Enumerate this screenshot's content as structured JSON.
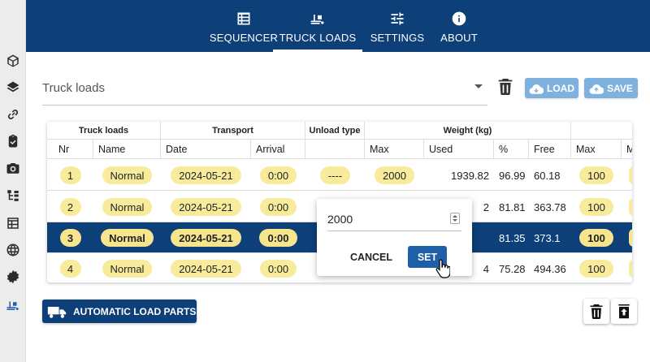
{
  "sidebar": {
    "items": [
      {
        "icon": "cube-icon"
      },
      {
        "icon": "layers-icon"
      },
      {
        "icon": "link-icon"
      },
      {
        "icon": "clipboard-check-icon"
      },
      {
        "icon": "camera-icon"
      },
      {
        "icon": "hierarchy-icon"
      },
      {
        "icon": "table-icon"
      },
      {
        "icon": "globe-icon"
      },
      {
        "icon": "gear-badge-icon"
      },
      {
        "icon": "truck-loading-icon",
        "active": true
      }
    ]
  },
  "nav": {
    "tabs": [
      {
        "label": "SEQUENCER",
        "icon": "list-icon"
      },
      {
        "label": "TRUCK LOADS",
        "icon": "truck-loading-icon",
        "active": true
      },
      {
        "label": "SETTINGS",
        "icon": "sliders-icon"
      },
      {
        "label": "ABOUT",
        "icon": "info-icon"
      }
    ]
  },
  "toolbar": {
    "select_value": "Truck loads",
    "load_label": "LOAD",
    "save_label": "SAVE"
  },
  "table": {
    "groups": [
      "Truck loads",
      "Transport",
      "Unload type",
      "Weight (kg)"
    ],
    "columns": [
      "Nr",
      "Name",
      "Date",
      "Arrival",
      "Max",
      "Used",
      "%",
      "Free",
      "Max",
      "M"
    ],
    "rows": [
      {
        "nr": "1",
        "name": "Normal",
        "date": "2024-05-21",
        "arrival": "0:00",
        "unload": "----",
        "max": "2000",
        "used": "1939.82",
        "pct": "96.99",
        "free": "60.18",
        "max2": "100",
        "selected": false
      },
      {
        "nr": "2",
        "name": "Normal",
        "date": "2024-05-21",
        "arrival": "0:00",
        "unload": "",
        "max": "",
        "used": "2",
        "pct": "81.81",
        "free": "363.78",
        "max2": "100",
        "selected": false
      },
      {
        "nr": "3",
        "name": "Normal",
        "date": "2024-05-21",
        "arrival": "0:00",
        "unload": "",
        "max": "",
        "used": "",
        "pct": "81.35",
        "free": "373.1",
        "max2": "100",
        "selected": true
      },
      {
        "nr": "4",
        "name": "Normal",
        "date": "2024-05-21",
        "arrival": "0:00",
        "unload": "",
        "max": "",
        "used": "4",
        "pct": "75.28",
        "free": "494.36",
        "max2": "100",
        "selected": false
      }
    ]
  },
  "popover": {
    "value": "2000",
    "cancel_label": "CANCEL",
    "set_label": "SET"
  },
  "bottom": {
    "auto_label": "AUTOMATIC LOAD PARTS"
  },
  "colors": {
    "primary": "#0d3f78",
    "accent_blue": "#1f5fa8",
    "light_button": "#7fb1de",
    "chip": "#f8ec9c"
  }
}
